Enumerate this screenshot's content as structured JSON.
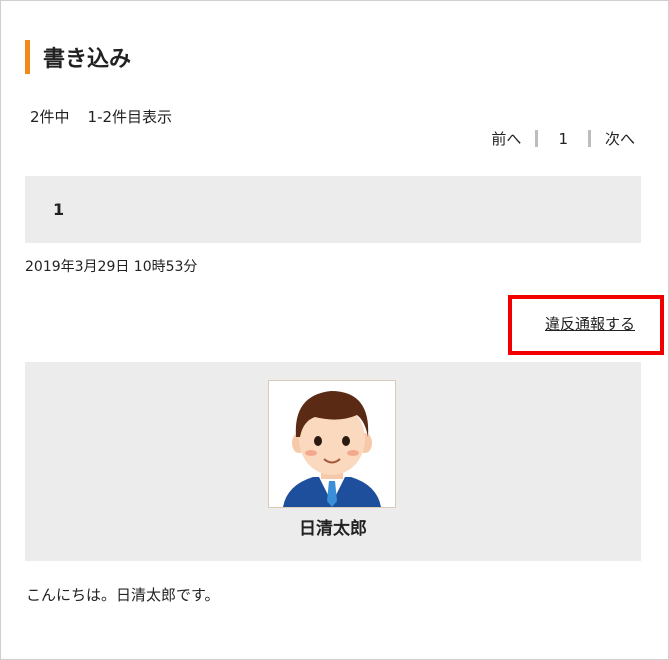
{
  "section": {
    "title": "書き込み"
  },
  "pagination": {
    "total": "2件中",
    "range": "1-2件目表示",
    "prev": "前へ",
    "page": "1",
    "next": "次へ"
  },
  "post": {
    "number": "1",
    "datetime": "2019年3月29日 10時53分",
    "report_label": "違反通報する",
    "author": "日清太郎",
    "message": "こんにちは。日清太郎です。"
  },
  "colors": {
    "accent": "#f28a1a",
    "highlight": "#f20000",
    "panel": "#ececec"
  }
}
